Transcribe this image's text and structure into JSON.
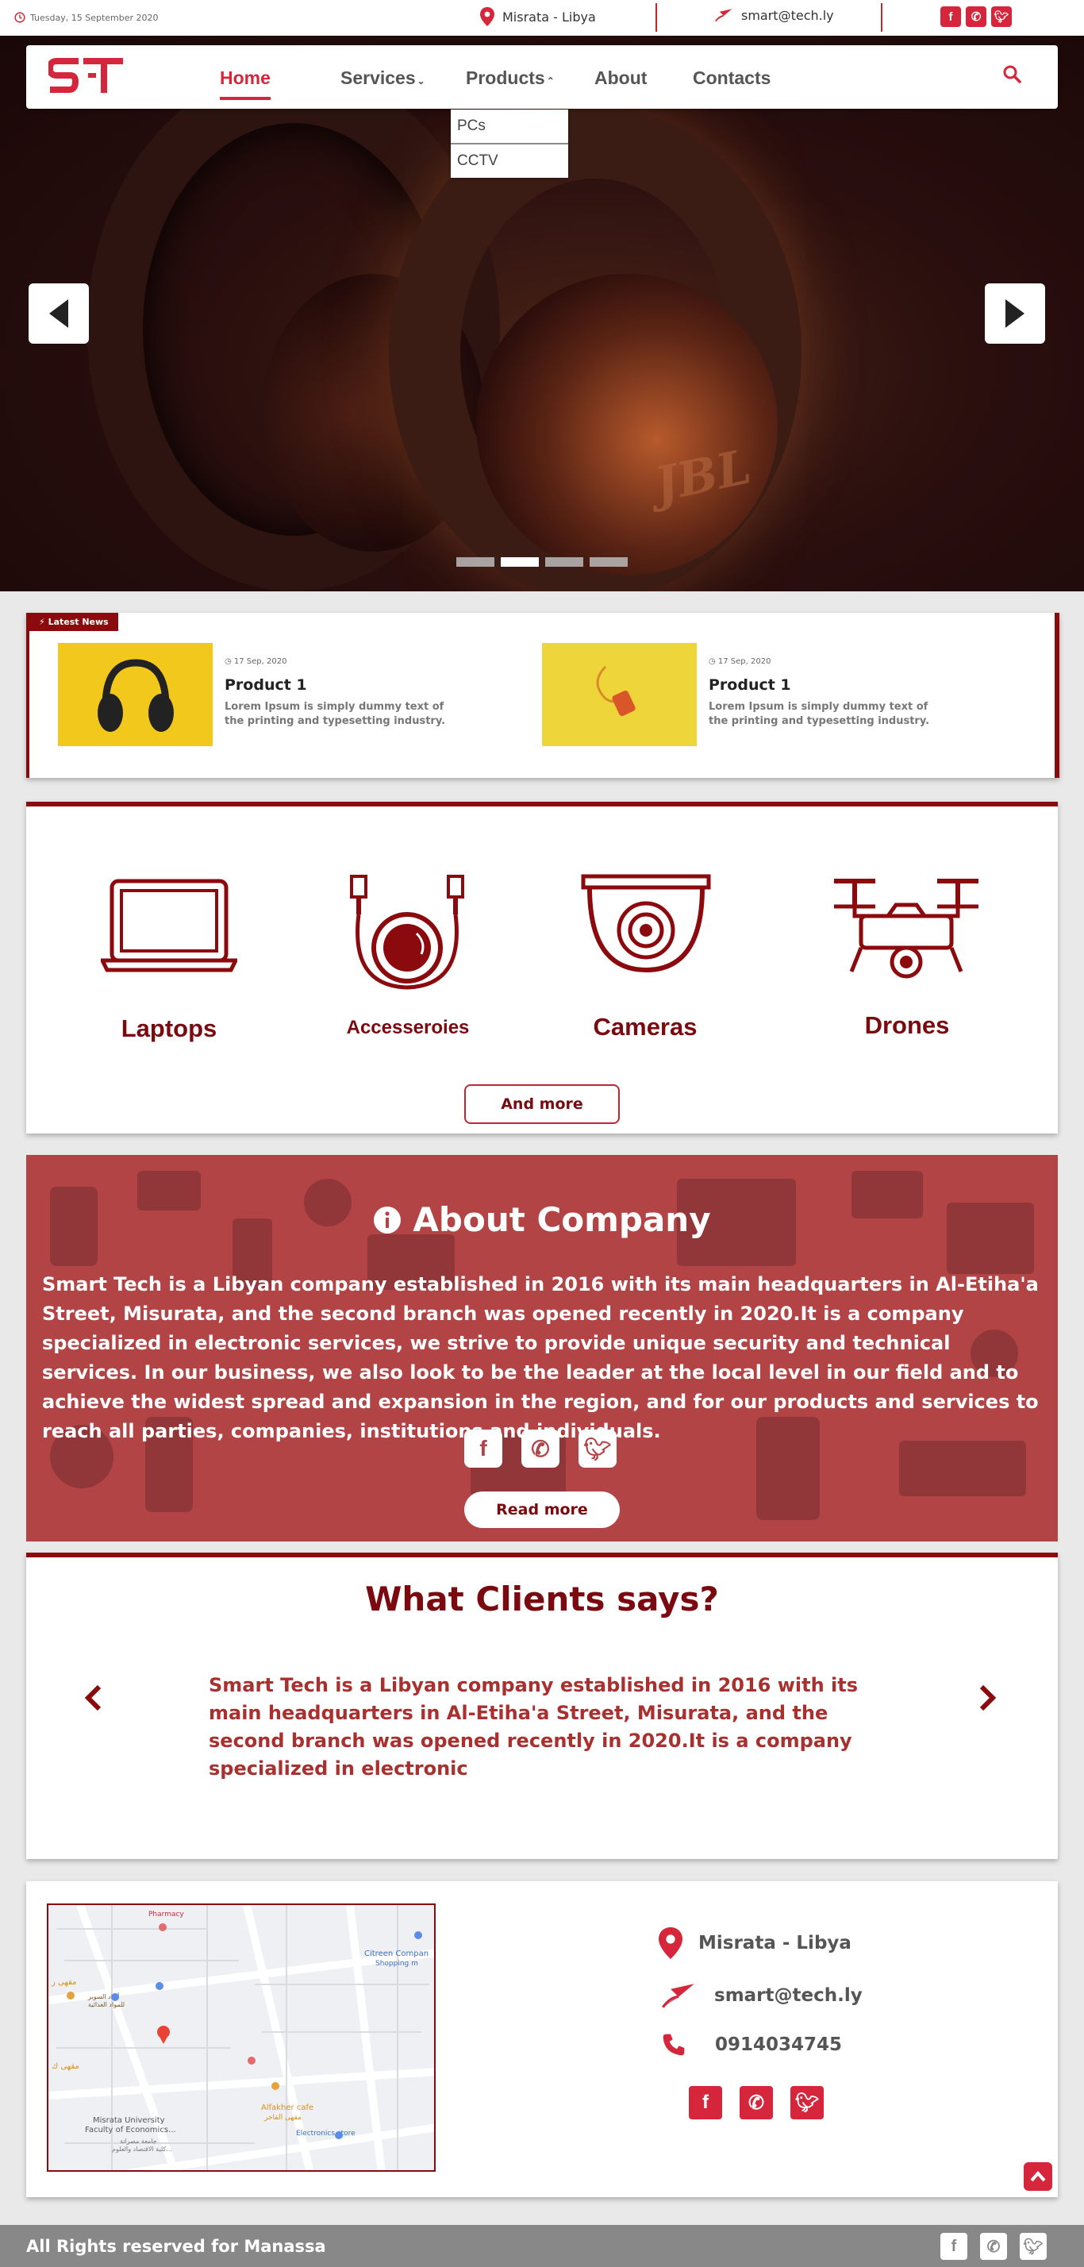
{
  "topbar": {
    "date": "Tuesday, 15 September 2020",
    "location": "Misrata - Libya",
    "email": "smart@tech.ly",
    "socials": [
      "facebook-icon",
      "whatsapp-icon",
      "twitter-icon"
    ]
  },
  "brand": {
    "logo": "ST",
    "accent": "#d6263b",
    "dark": "#8b0a0e"
  },
  "nav": {
    "items": [
      {
        "label": "Home",
        "active": true
      },
      {
        "label": "Services",
        "caret": "⌄"
      },
      {
        "label": "Products",
        "caret": "⌃"
      },
      {
        "label": "About"
      },
      {
        "label": "Contacts"
      }
    ],
    "products_dropdown": [
      "PCs",
      "CCTV"
    ]
  },
  "hero": {
    "brand_text": "JBL",
    "slides": 4,
    "active_slide": 2
  },
  "news": {
    "tag": "Latest News",
    "items": [
      {
        "date": "17 Sep, 2020",
        "title": "Product 1",
        "text": "Lorem Ipsum is simply dummy text of the printing and typesetting industry."
      },
      {
        "date": "17 Sep, 2020",
        "title": "Product 1",
        "text": "Lorem Ipsum is simply dummy text of the printing and typesetting industry."
      }
    ]
  },
  "categories": {
    "items": [
      "Laptops",
      "Accesseroies",
      "Cameras",
      "Drones"
    ],
    "more_button": "And more"
  },
  "about": {
    "title": "About Company",
    "text": "Smart Tech is a Libyan company established in 2016 with its main headquarters in Al-Etiha'a Street, Misurata, and the second branch was opened recently in 2020.It is a company specialized in electronic services, we strive to provide unique security and technical services. In our business, we also look to be the leader at the local level in our field and to achieve the widest spread and expansion in the region, and for our products and services to reach all parties, companies, institutions and individuals.",
    "read_more": "Read more"
  },
  "clients": {
    "title": "What Clients says?",
    "text": "Smart Tech is a Libyan company established in 2016 with its main headquarters in Al-Etiha'a Street, Misurata, and the second branch was opened recently in 2020.It is a company specialized in electronic"
  },
  "contact": {
    "location": "Misrata - Libya",
    "email": "smart@tech.ly",
    "phone": "0914034745",
    "map_labels": {
      "pharmacy": "Pharmacy",
      "citreen": "Citreen Compan",
      "citreen2": "Shopping m",
      "cafe_ar": "مقهى ر",
      "store_ar1": "أولاد السوبر",
      "store_ar2": "للمواد الغذائية",
      "cafe2_ar": "مقهى ك",
      "alfakher": "Alfakher cafe",
      "alfakher_ar": "مقهى الفاخر",
      "electronics": "Electronics store",
      "university": "Misrata University",
      "faculty": "Faculty of Economics...",
      "uni_ar1": "جامعة مصراتة",
      "uni_ar2": "كلية الاقتصاد والعلوم..."
    }
  },
  "footer": {
    "copyright": "All Rights reserved for Manassa"
  }
}
